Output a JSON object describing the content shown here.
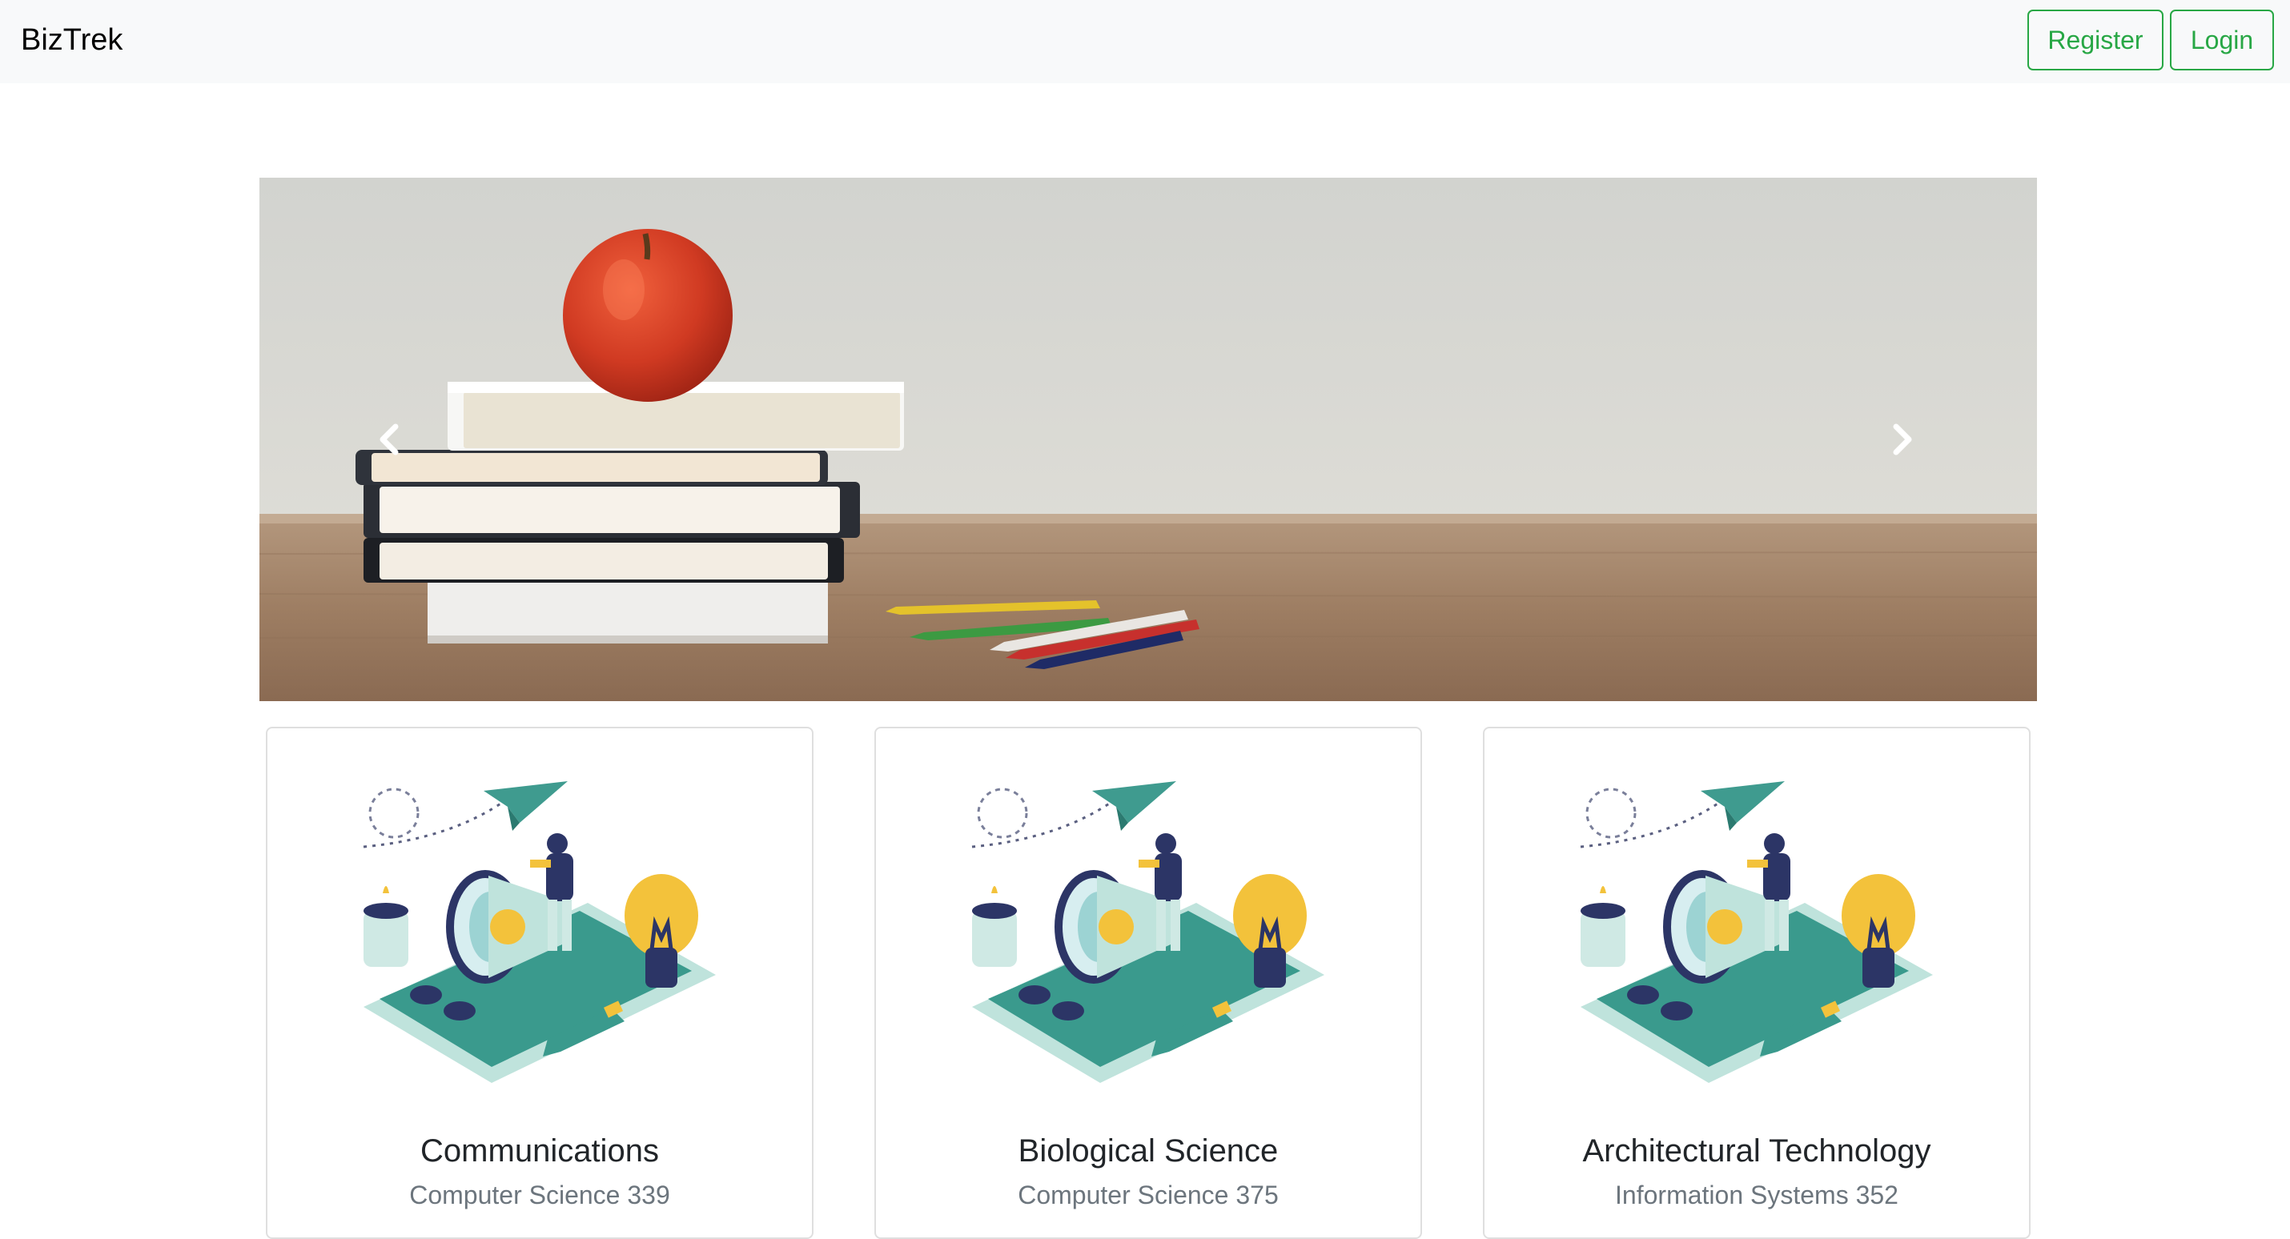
{
  "navbar": {
    "brand": "BizTrek",
    "register_label": "Register",
    "login_label": "Login"
  },
  "carousel": {
    "prev_icon": "chevron-left-icon",
    "next_icon": "chevron-right-icon"
  },
  "courses": [
    {
      "title": "Communications",
      "subtitle": "Computer Science 339"
    },
    {
      "title": "Biological Science",
      "subtitle": "Computer Science 375"
    },
    {
      "title": "Architectural Technology",
      "subtitle": "Information Systems 352"
    }
  ],
  "colors": {
    "accent": "#28a745",
    "navbar_bg": "#f8f9fa",
    "muted_text": "#6c757d"
  }
}
